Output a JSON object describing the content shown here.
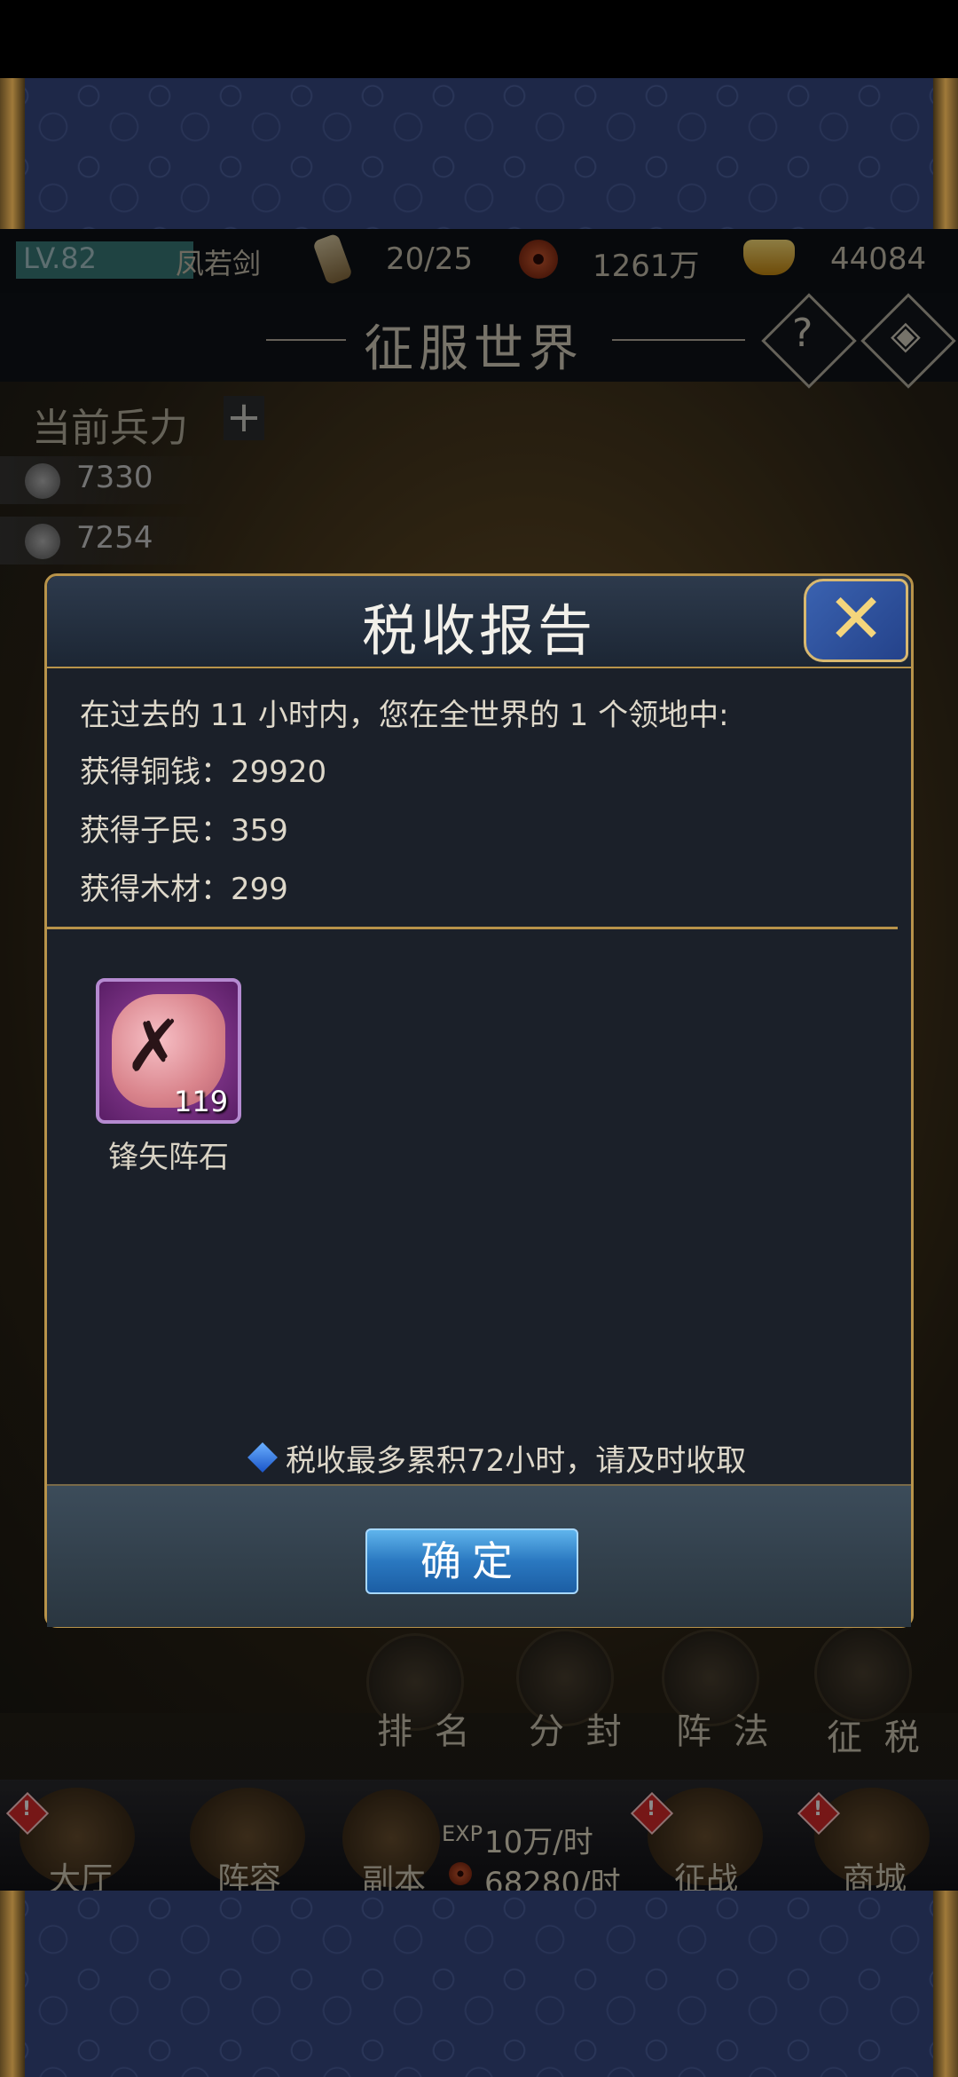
{
  "status": {
    "level": "LV.82",
    "player_name": "凤若剑",
    "stamina": "20/25",
    "coins": "1261万",
    "gold": "44084"
  },
  "header": {
    "title": "征服世界"
  },
  "troops": {
    "label": "当前兵力",
    "plus": "+",
    "rows": [
      "7330",
      "7254"
    ]
  },
  "sub_buttons": [
    "排 名",
    "分 封",
    "阵 法",
    "征 税"
  ],
  "bottom_nav": {
    "hall": "大厅",
    "lineup": "阵容",
    "dungeon": "副本",
    "exp_rate": "10万/时",
    "exp_prefix": "EXP",
    "coin_rate": "68280/时",
    "battle": "征战",
    "shop": "商城",
    "badge": "!"
  },
  "dialog": {
    "title": "税收报告",
    "close": "✕",
    "summary": "在过去的 11 小时内，您在全世界的 1 个领地中:",
    "gains": [
      "获得铜钱：29920",
      "获得子民：359",
      "获得木材：299"
    ],
    "item": {
      "name": "锋矢阵石",
      "count": "119"
    },
    "note": "税收最多累积72小时，请及时收取",
    "ok": "确定"
  }
}
